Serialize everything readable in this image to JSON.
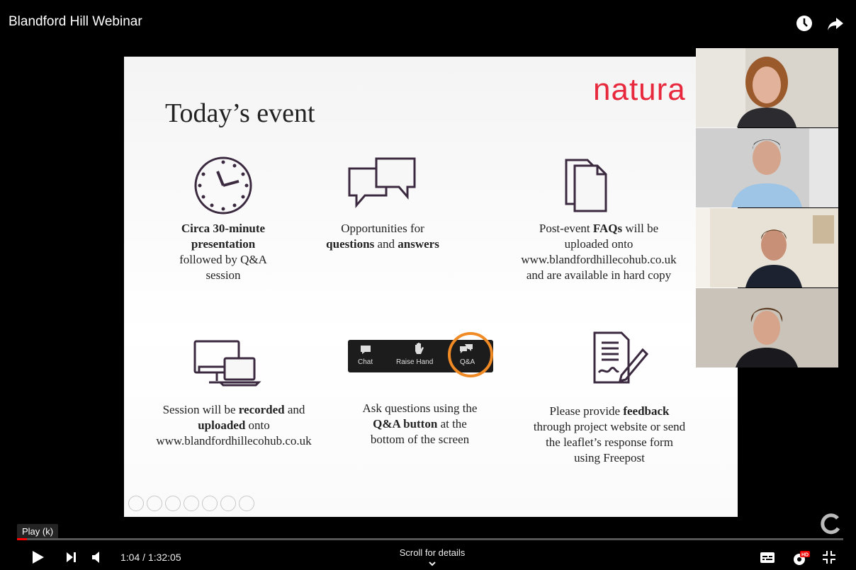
{
  "window": {
    "title": "Blandford Hill Webinar"
  },
  "slide": {
    "logo": "natura",
    "title": "Today’s event",
    "items": [
      {
        "parts": [
          [
            "Circa 30-minute",
            true
          ],
          [
            "presentation",
            true
          ],
          [
            "followed by Q&A",
            false
          ],
          [
            "session",
            false
          ]
        ]
      },
      {
        "parts": [
          [
            "Opportunities for",
            false
          ]
        ],
        "line2": [
          [
            "questions",
            true
          ],
          [
            " and ",
            false
          ],
          [
            "answers",
            true
          ]
        ]
      },
      {
        "parts": [
          [
            "Post-event ",
            false
          ],
          [
            "FAQs",
            true
          ],
          [
            " will be",
            false
          ]
        ],
        "rest": [
          "uploaded onto",
          "www.blandfordhillecohub.co.uk",
          "and are available in hard copy"
        ]
      },
      {
        "l1": [
          [
            "Session will be ",
            false
          ],
          [
            "recorded",
            true
          ],
          [
            " and",
            false
          ]
        ],
        "l2": [
          [
            "uploaded",
            true
          ],
          [
            " onto",
            false
          ]
        ],
        "l3": "www.blandfordhillecohub.co.uk"
      },
      {
        "l1": "Ask questions using the",
        "l2": [
          [
            "Q&A button",
            true
          ],
          [
            " at the",
            false
          ]
        ],
        "l3": "bottom of the screen"
      },
      {
        "l1": [
          [
            "Please provide ",
            false
          ],
          [
            "feedback",
            true
          ]
        ],
        "l2": "through project website or send",
        "l3": "the leaflet’s response form",
        "l4": "using Freepost"
      }
    ],
    "zoombar": {
      "chat": "Chat",
      "raise": "Raise Hand",
      "qa": "Q&A"
    }
  },
  "controls": {
    "tooltip": "Play (k)",
    "time_current": "1:04",
    "time_separator": " / ",
    "time_total": "1:32:05",
    "scroll_hint": "Scroll for details",
    "progress_fraction": 0.0116
  },
  "colors": {
    "logo": "#e8283c",
    "icon": "#3b2a3f",
    "progress": "#ff0000",
    "highlight": "#f08a24"
  }
}
